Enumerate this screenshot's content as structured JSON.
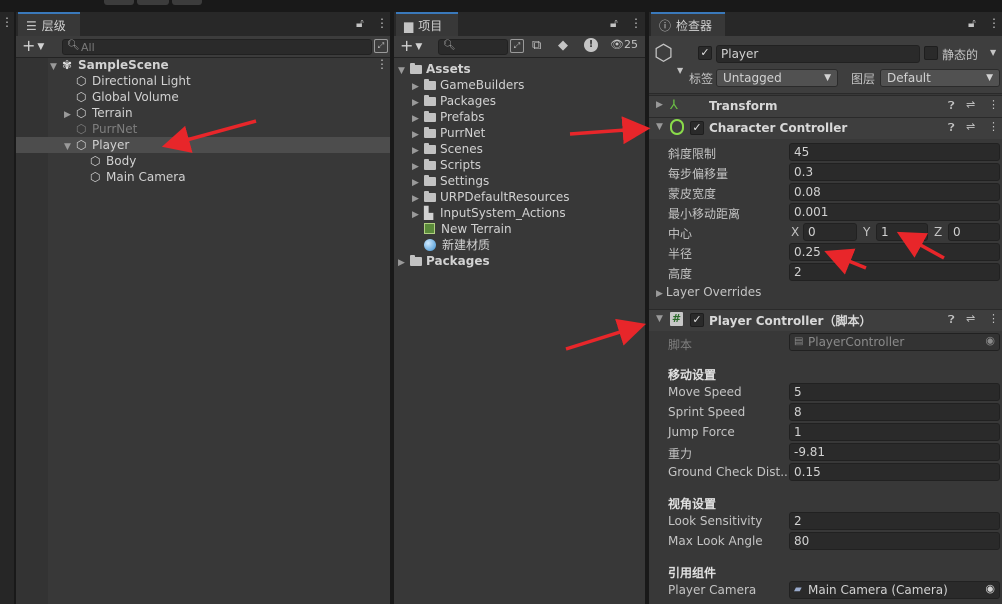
{
  "hierarchy": {
    "tab_label": "层级",
    "search_placeholder": "All",
    "items": [
      {
        "label": "SampleScene",
        "depth": 0,
        "expanded": true,
        "bold": true
      },
      {
        "label": "Directional Light",
        "depth": 1
      },
      {
        "label": "Global Volume",
        "depth": 1
      },
      {
        "label": "Terrain",
        "depth": 1,
        "collapsed": true
      },
      {
        "label": "PurrNet",
        "depth": 1,
        "dimmed": true
      },
      {
        "label": "Player",
        "depth": 1,
        "expanded": true,
        "selected": true
      },
      {
        "label": "Body",
        "depth": 2
      },
      {
        "label": "Main Camera",
        "depth": 2
      }
    ]
  },
  "project": {
    "tab_label": "项目",
    "visibility_count": "25",
    "items": [
      {
        "label": "Assets",
        "type": "folder-open",
        "depth": 0,
        "bold": true
      },
      {
        "label": "GameBuilders",
        "type": "folder",
        "depth": 1
      },
      {
        "label": "Packages",
        "type": "folder",
        "depth": 1
      },
      {
        "label": "Prefabs",
        "type": "folder",
        "depth": 1
      },
      {
        "label": "PurrNet",
        "type": "folder",
        "depth": 1
      },
      {
        "label": "Scenes",
        "type": "folder",
        "depth": 1
      },
      {
        "label": "Scripts",
        "type": "folder",
        "depth": 1
      },
      {
        "label": "Settings",
        "type": "folder",
        "depth": 1
      },
      {
        "label": "URPDefaultResources",
        "type": "folder",
        "depth": 1
      },
      {
        "label": "InputSystem_Actions",
        "type": "input-actions",
        "depth": 1
      },
      {
        "label": "New Terrain",
        "type": "terrain-asset",
        "depth": 1
      },
      {
        "label": "新建材质",
        "type": "material",
        "depth": 1
      },
      {
        "label": "Packages",
        "type": "folder",
        "depth": 0,
        "bold": true
      }
    ]
  },
  "inspector": {
    "tab_label": "检查器",
    "object_name": "Player",
    "static_label": "静态的",
    "tag_label": "标签",
    "tag_value": "Untagged",
    "layer_label": "图层",
    "layer_value": "Default",
    "transform": {
      "title": "Transform"
    },
    "character_controller": {
      "title": "Character Controller",
      "slope_label": "斜度限制",
      "slope_value": "45",
      "step_label": "每步偏移量",
      "step_value": "0.3",
      "skin_label": "蒙皮宽度",
      "skin_value": "0.08",
      "min_move_label": "最小移动距离",
      "min_move_value": "0.001",
      "center_label": "中心",
      "center_x_label": "X",
      "center_x": "0",
      "center_y_label": "Y",
      "center_y": "1",
      "center_z_label": "Z",
      "center_z": "0",
      "radius_label": "半径",
      "radius_value": "0.25",
      "height_label": "高度",
      "height_value": "2",
      "layer_overrides": "Layer Overrides"
    },
    "player_controller": {
      "title": "Player Controller（脚本）",
      "script_label": "脚本",
      "script_value": "PlayerController",
      "move_section": "移动设置",
      "move_speed_label": "Move Speed",
      "move_speed": "5",
      "sprint_speed_label": "Sprint Speed",
      "sprint_speed": "8",
      "jump_force_label": "Jump Force",
      "jump_force": "1",
      "gravity_label": "重力",
      "gravity": "-9.81",
      "ground_check_label": "Ground Check Dist...",
      "ground_check": "0.15",
      "look_section": "视角设置",
      "look_sens_label": "Look Sensitivity",
      "look_sens": "2",
      "max_look_label": "Max Look Angle",
      "max_look": "80",
      "ref_section": "引用组件",
      "player_camera_label": "Player Camera",
      "player_camera_value": "Main Camera (Camera)"
    }
  },
  "colors": {
    "panel_bg": "#383838",
    "selection": "#4d4d4d",
    "accent_tab": "#3a79bb",
    "annotation_arrow": "#e8262a"
  }
}
